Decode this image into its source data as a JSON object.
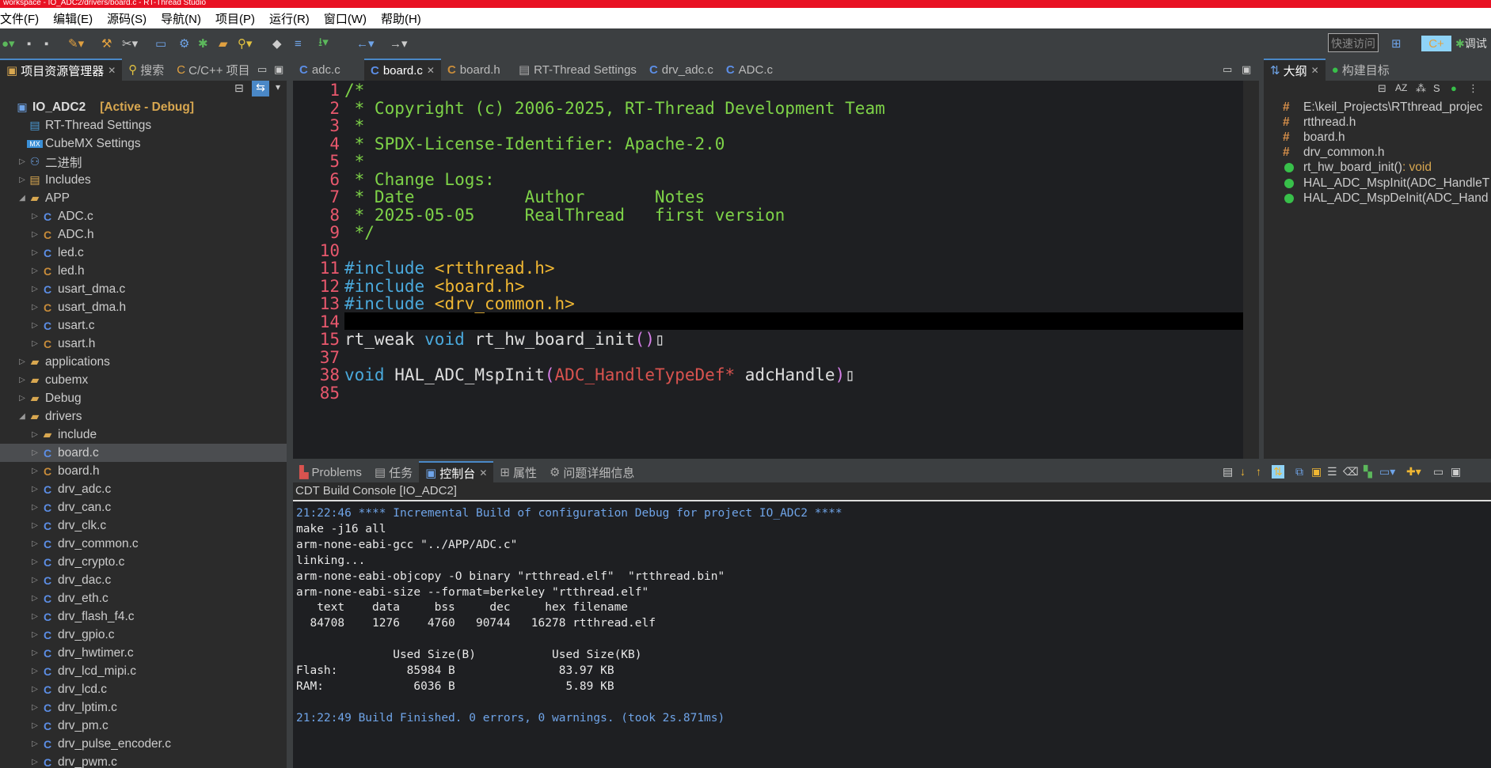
{
  "window": {
    "title": "workspace - IO_ADC2/drivers/board.c - RT-Thread Studio"
  },
  "menu": [
    "文件(F)",
    "编辑(E)",
    "源码(S)",
    "导航(N)",
    "项目(P)",
    "运行(R)",
    "窗口(W)",
    "帮助(H)"
  ],
  "toolbar": {
    "quick_access_placeholder": "快速访问",
    "debug_label": "调试"
  },
  "left_tabs": [
    {
      "label": "项目资源管理器",
      "active": true
    },
    {
      "label": "搜索"
    },
    {
      "label": "C/C++ 项目"
    }
  ],
  "tree": [
    {
      "label": "IO_ADC2",
      "status": "[Active - Debug]",
      "icon": "project-icon",
      "indent": 0,
      "expanded": true
    },
    {
      "label": "RT-Thread Settings",
      "icon": "settings-icon",
      "indent": 1
    },
    {
      "label": "CubeMX Settings",
      "icon": "mx-icon",
      "indent": 1
    },
    {
      "label": "二进制",
      "icon": "binary-icon",
      "indent": 1,
      "arrow": "collapsed"
    },
    {
      "label": "Includes",
      "icon": "includes-icon",
      "indent": 1,
      "arrow": "collapsed"
    },
    {
      "label": "APP",
      "icon": "folder-icon",
      "indent": 1,
      "arrow": "expanded"
    },
    {
      "label": "ADC.c",
      "icon": "c-file-icon",
      "indent": 2,
      "arrow": "collapsed"
    },
    {
      "label": "ADC.h",
      "icon": "h-file-icon",
      "indent": 2,
      "arrow": "collapsed"
    },
    {
      "label": "led.c",
      "icon": "c-file-icon",
      "indent": 2,
      "arrow": "collapsed"
    },
    {
      "label": "led.h",
      "icon": "h-file-icon",
      "indent": 2,
      "arrow": "collapsed"
    },
    {
      "label": "usart_dma.c",
      "icon": "c-file-icon",
      "indent": 2,
      "arrow": "collapsed"
    },
    {
      "label": "usart_dma.h",
      "icon": "h-file-icon",
      "indent": 2,
      "arrow": "collapsed"
    },
    {
      "label": "usart.c",
      "icon": "c-file-icon",
      "indent": 2,
      "arrow": "collapsed"
    },
    {
      "label": "usart.h",
      "icon": "h-file-icon",
      "indent": 2,
      "arrow": "collapsed"
    },
    {
      "label": "applications",
      "icon": "folder-icon",
      "indent": 1,
      "arrow": "collapsed"
    },
    {
      "label": "cubemx",
      "icon": "folder-icon",
      "indent": 1,
      "arrow": "collapsed"
    },
    {
      "label": "Debug",
      "icon": "folder-icon",
      "indent": 1,
      "arrow": "collapsed"
    },
    {
      "label": "drivers",
      "icon": "folder-icon",
      "indent": 1,
      "arrow": "expanded"
    },
    {
      "label": "include",
      "icon": "folder-icon",
      "indent": 2,
      "arrow": "collapsed"
    },
    {
      "label": "board.c",
      "icon": "c-file-icon",
      "indent": 2,
      "arrow": "collapsed",
      "selected": true
    },
    {
      "label": "board.h",
      "icon": "h-file-icon",
      "indent": 2,
      "arrow": "collapsed"
    },
    {
      "label": "drv_adc.c",
      "icon": "c-file-icon",
      "indent": 2,
      "arrow": "collapsed"
    },
    {
      "label": "drv_can.c",
      "icon": "c-file-icon",
      "indent": 2,
      "arrow": "collapsed"
    },
    {
      "label": "drv_clk.c",
      "icon": "c-file-icon",
      "indent": 2,
      "arrow": "collapsed"
    },
    {
      "label": "drv_common.c",
      "icon": "c-file-icon",
      "indent": 2,
      "arrow": "collapsed"
    },
    {
      "label": "drv_crypto.c",
      "icon": "c-file-icon",
      "indent": 2,
      "arrow": "collapsed"
    },
    {
      "label": "drv_dac.c",
      "icon": "c-file-icon",
      "indent": 2,
      "arrow": "collapsed"
    },
    {
      "label": "drv_eth.c",
      "icon": "c-file-icon",
      "indent": 2,
      "arrow": "collapsed"
    },
    {
      "label": "drv_flash_f4.c",
      "icon": "c-file-icon",
      "indent": 2,
      "arrow": "collapsed"
    },
    {
      "label": "drv_gpio.c",
      "icon": "c-file-icon",
      "indent": 2,
      "arrow": "collapsed"
    },
    {
      "label": "drv_hwtimer.c",
      "icon": "c-file-icon",
      "indent": 2,
      "arrow": "collapsed"
    },
    {
      "label": "drv_lcd_mipi.c",
      "icon": "c-file-icon",
      "indent": 2,
      "arrow": "collapsed"
    },
    {
      "label": "drv_lcd.c",
      "icon": "c-file-icon",
      "indent": 2,
      "arrow": "collapsed"
    },
    {
      "label": "drv_lptim.c",
      "icon": "c-file-icon",
      "indent": 2,
      "arrow": "collapsed"
    },
    {
      "label": "drv_pm.c",
      "icon": "c-file-icon",
      "indent": 2,
      "arrow": "collapsed"
    },
    {
      "label": "drv_pulse_encoder.c",
      "icon": "c-file-icon",
      "indent": 2,
      "arrow": "collapsed"
    },
    {
      "label": "drv_pwm.c",
      "icon": "c-file-icon",
      "indent": 2,
      "arrow": "collapsed"
    }
  ],
  "editor_tabs": [
    {
      "label": "adc.c",
      "icon": "c-file-icon"
    },
    {
      "label": "board.c",
      "icon": "c-file-icon",
      "active": true
    },
    {
      "label": "board.h",
      "icon": "h-file-icon"
    },
    {
      "label": "RT-Thread Settings",
      "icon": "settings-icon"
    },
    {
      "label": "drv_adc.c",
      "icon": "c-file-icon"
    },
    {
      "label": "ADC.c",
      "icon": "c-file-icon"
    }
  ],
  "code_lines": [
    {
      "n": "1",
      "segs": [
        [
          "cm",
          "/*"
        ]
      ]
    },
    {
      "n": "2",
      "segs": [
        [
          "cm",
          " * Copyright (c) 2006-2025, RT-Thread Development Team"
        ]
      ]
    },
    {
      "n": "3",
      "segs": [
        [
          "cm",
          " *"
        ]
      ]
    },
    {
      "n": "4",
      "segs": [
        [
          "cm",
          " * SPDX-License-Identifier: Apache-2.0"
        ]
      ]
    },
    {
      "n": "5",
      "segs": [
        [
          "cm",
          " *"
        ]
      ]
    },
    {
      "n": "6",
      "segs": [
        [
          "cm",
          " * Change Logs:"
        ]
      ]
    },
    {
      "n": "7",
      "segs": [
        [
          "cm",
          " * Date           Author       Notes"
        ]
      ]
    },
    {
      "n": "8",
      "segs": [
        [
          "cm",
          " * 2025-05-05     RealThread   first version"
        ]
      ]
    },
    {
      "n": "9",
      "segs": [
        [
          "cm",
          " */"
        ]
      ]
    },
    {
      "n": "10",
      "segs": []
    },
    {
      "n": "11",
      "segs": [
        [
          "pp",
          "#include "
        ],
        [
          "inc",
          "<rtthread.h>"
        ]
      ]
    },
    {
      "n": "12",
      "segs": [
        [
          "pp",
          "#include "
        ],
        [
          "inc",
          "<board.h>"
        ]
      ]
    },
    {
      "n": "13",
      "segs": [
        [
          "pp",
          "#include "
        ],
        [
          "inc",
          "<drv_common.h>"
        ]
      ]
    },
    {
      "n": "14",
      "segs": []
    },
    {
      "n": "15",
      "segs": [
        [
          "fn",
          "rt_weak "
        ],
        [
          "kw",
          "void "
        ],
        [
          "fn",
          "rt_hw_board_init"
        ],
        [
          "par",
          "()"
        ],
        [
          "fn",
          "▯"
        ]
      ]
    },
    {
      "n": "37",
      "segs": []
    },
    {
      "n": "38",
      "segs": [
        [
          "kw",
          "void "
        ],
        [
          "fn",
          "HAL_ADC_MspInit"
        ],
        [
          "par",
          "("
        ],
        [
          "type",
          "ADC_HandleTypeDef*"
        ],
        [
          "fn",
          " adcHandle"
        ],
        [
          "par",
          ")"
        ],
        [
          "fn",
          "▯"
        ]
      ]
    },
    {
      "n": "85",
      "segs": []
    }
  ],
  "right_tabs": [
    {
      "label": "大纲",
      "active": true
    },
    {
      "label": "构建目标"
    }
  ],
  "outline": [
    {
      "kind": "include",
      "label": "E:\\keil_Projects\\RTthread_projec"
    },
    {
      "kind": "include",
      "label": "rtthread.h"
    },
    {
      "kind": "include",
      "label": "board.h"
    },
    {
      "kind": "include",
      "label": "drv_common.h"
    },
    {
      "kind": "func",
      "label": "rt_hw_board_init()",
      "type": " : void"
    },
    {
      "kind": "func",
      "label": "HAL_ADC_MspInit(ADC_HandleT",
      "type": ""
    },
    {
      "kind": "func",
      "label": "HAL_ADC_MspDeInit(ADC_Hand",
      "type": ""
    }
  ],
  "bottom_tabs": [
    {
      "label": "Problems"
    },
    {
      "label": "任务"
    },
    {
      "label": "控制台",
      "active": true
    },
    {
      "label": "属性"
    },
    {
      "label": "问题详细信息"
    }
  ],
  "console": {
    "title": "CDT Build Console [IO_ADC2]",
    "lines": [
      {
        "text": "21:22:46 **** Incremental Build of configuration Debug for project IO_ADC2 ****",
        "blue": true
      },
      {
        "text": "make -j16 all"
      },
      {
        "text": "arm-none-eabi-gcc \"../APP/ADC.c\""
      },
      {
        "text": "linking..."
      },
      {
        "text": "arm-none-eabi-objcopy -O binary \"rtthread.elf\"  \"rtthread.bin\""
      },
      {
        "text": "arm-none-eabi-size --format=berkeley \"rtthread.elf\""
      },
      {
        "text": "   text    data     bss     dec     hex filename"
      },
      {
        "text": "  84708    1276    4760   90744   16278 rtthread.elf"
      },
      {
        "text": ""
      },
      {
        "text": "              Used Size(B)           Used Size(KB)"
      },
      {
        "text": "Flash:          85984 B               83.97 KB"
      },
      {
        "text": "RAM:             6036 B                5.89 KB"
      },
      {
        "text": ""
      },
      {
        "text": "21:22:49 Build Finished. 0 errors, 0 warnings. (took 2s.871ms)",
        "blue": true
      }
    ]
  },
  "colors": {
    "accent": "#4a88c7",
    "line_numbers": "#e9586d",
    "comment": "#7ed348",
    "title_bar": "#e81123"
  }
}
